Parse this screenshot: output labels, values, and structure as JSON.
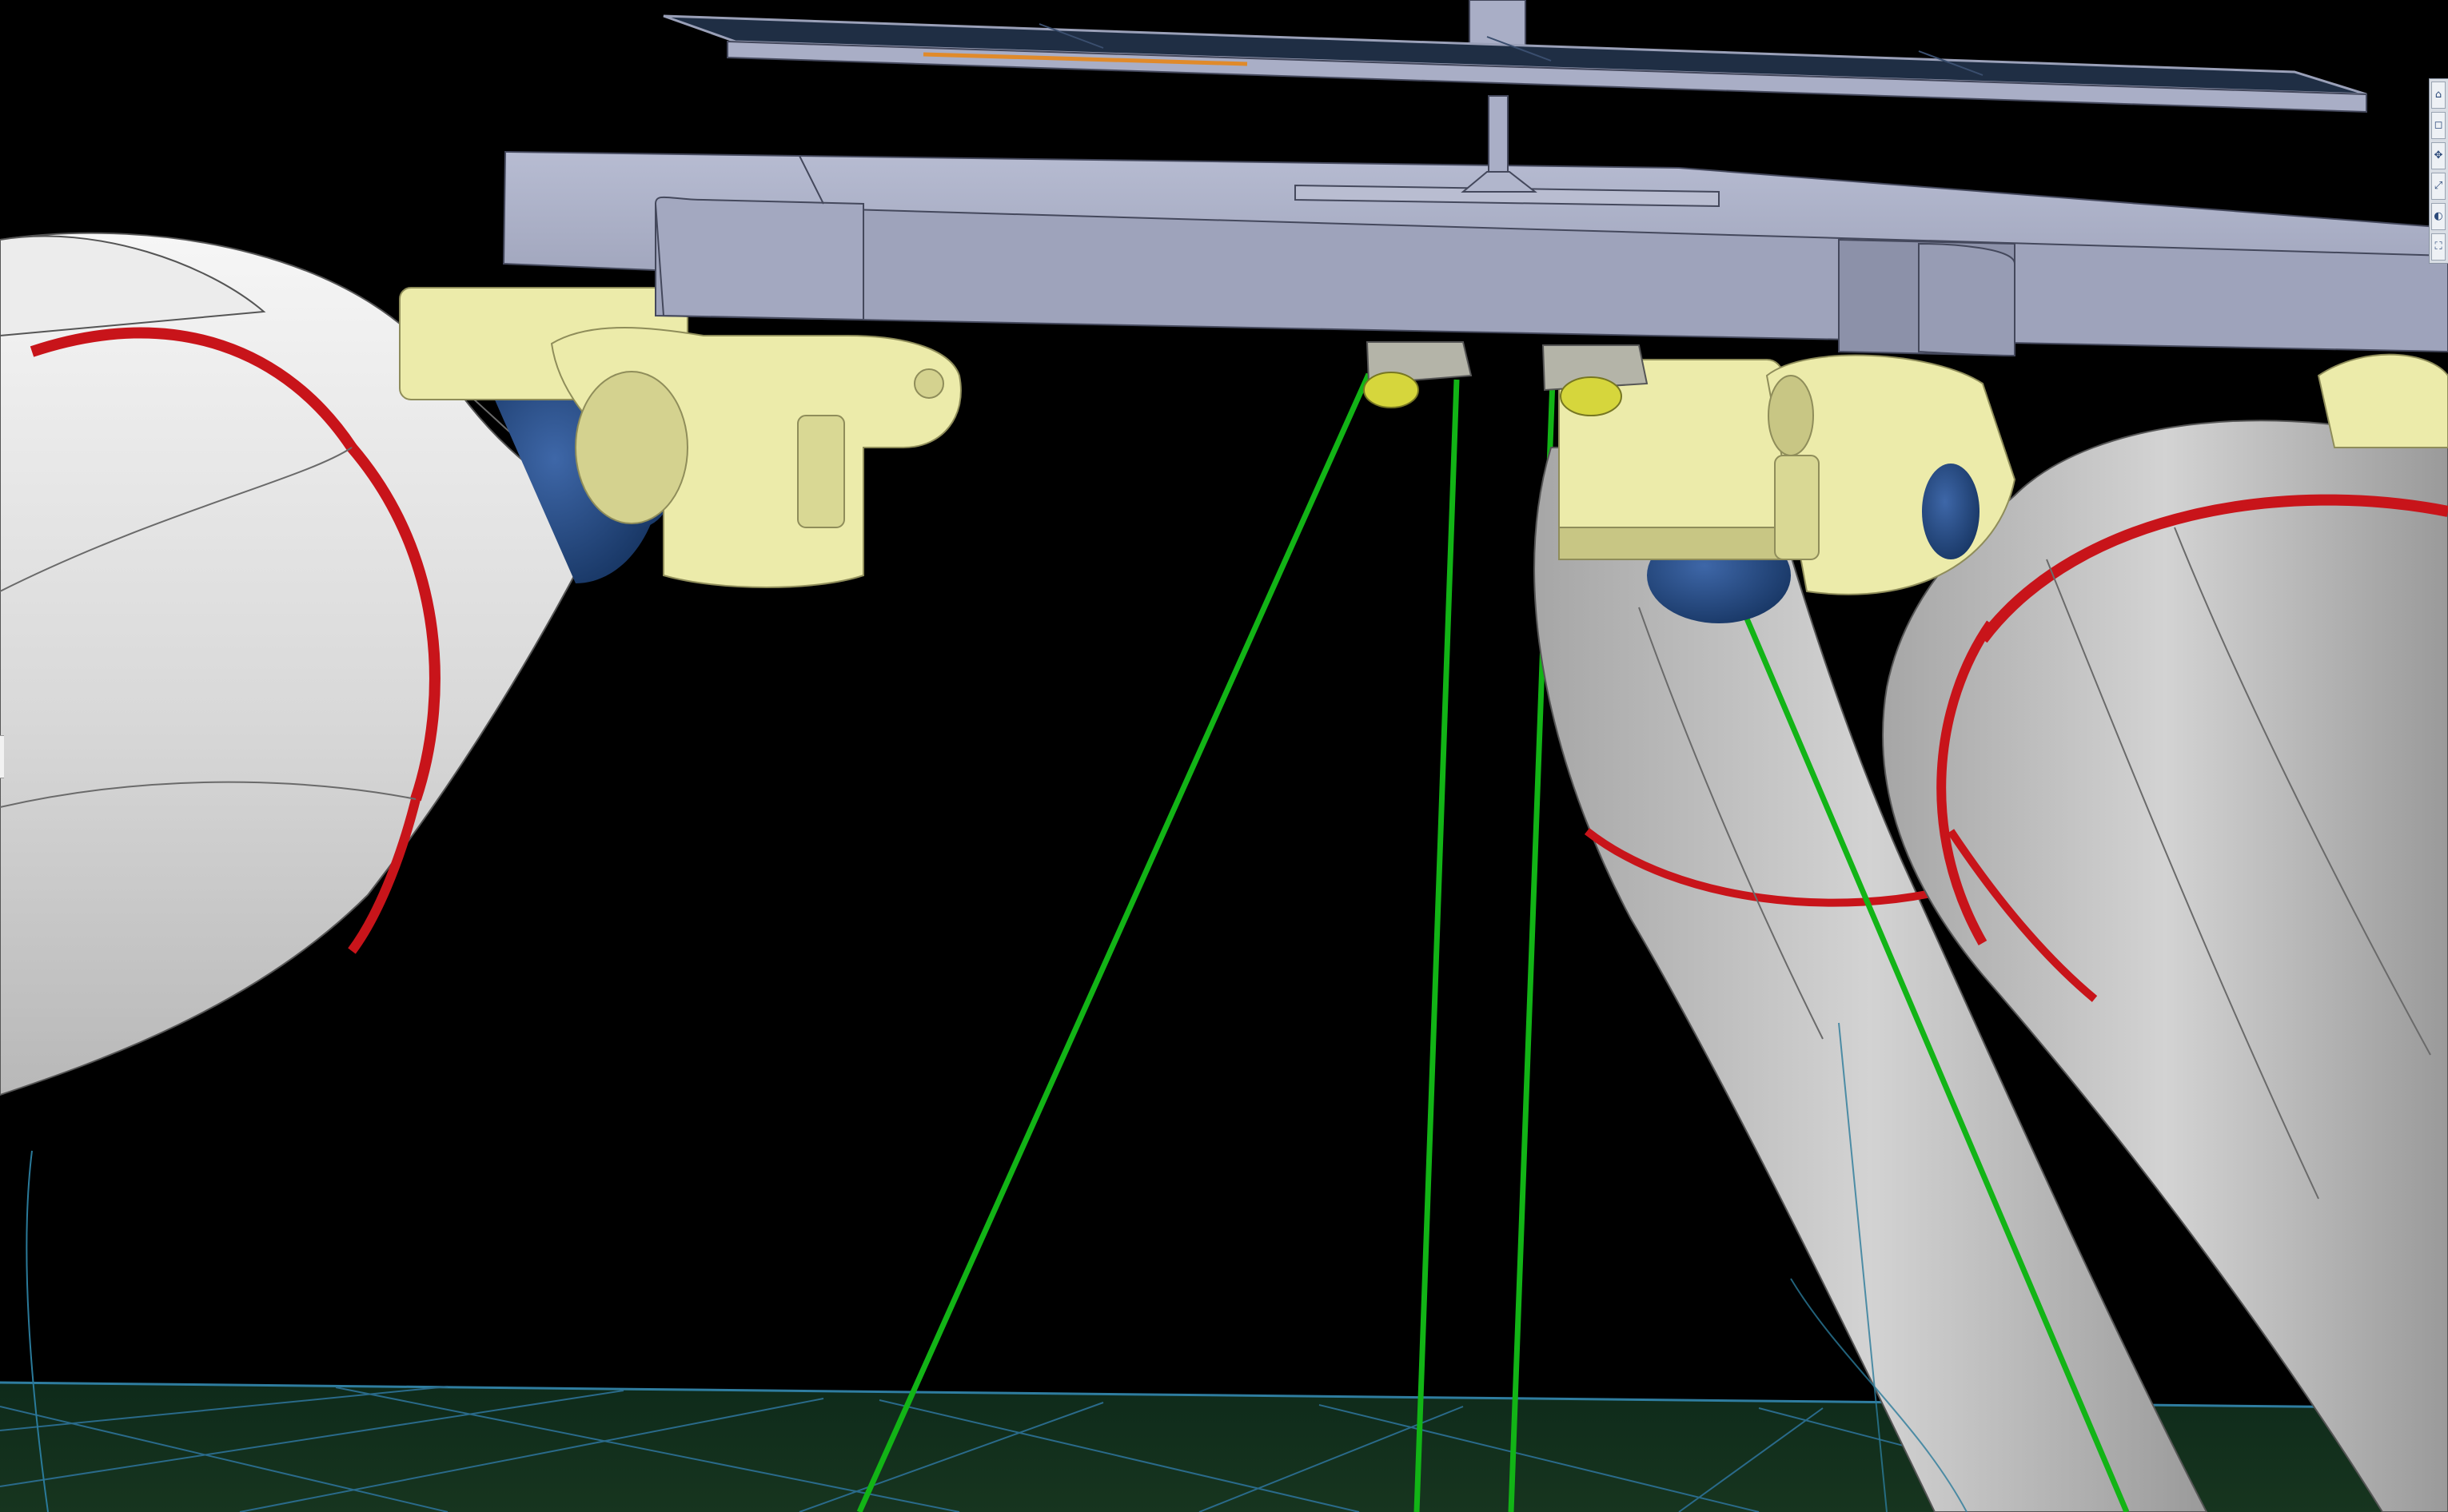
{
  "viewport": {
    "view_type": "3d-cad-viewport",
    "colors": {
      "background": "#000000",
      "frame": "#a9aec6",
      "frame_dark": "#7f849c",
      "solar_panel": "#1f2e44",
      "bracket": "#ecebaa",
      "bracket_dark": "#c8c684",
      "joint": "#24497f",
      "limb": "#e4e4e4",
      "limb_shadow": "#9c9c9c",
      "band": "#c8141a",
      "cable": "#12b416",
      "pulley": "#d6d63c",
      "ground_grid": "#2a6a8a",
      "ground_fill": "#0d2616"
    }
  },
  "toolbar": {
    "buttons": [
      {
        "icon": "home-view-icon",
        "glyph": "⌂"
      },
      {
        "icon": "box-view-icon",
        "glyph": "◻"
      },
      {
        "icon": "pan-icon",
        "glyph": "✥"
      },
      {
        "icon": "zoom-icon",
        "glyph": "⤢"
      },
      {
        "icon": "orbit-icon",
        "glyph": "◐"
      },
      {
        "icon": "fit-view-icon",
        "glyph": "⛶"
      }
    ]
  }
}
